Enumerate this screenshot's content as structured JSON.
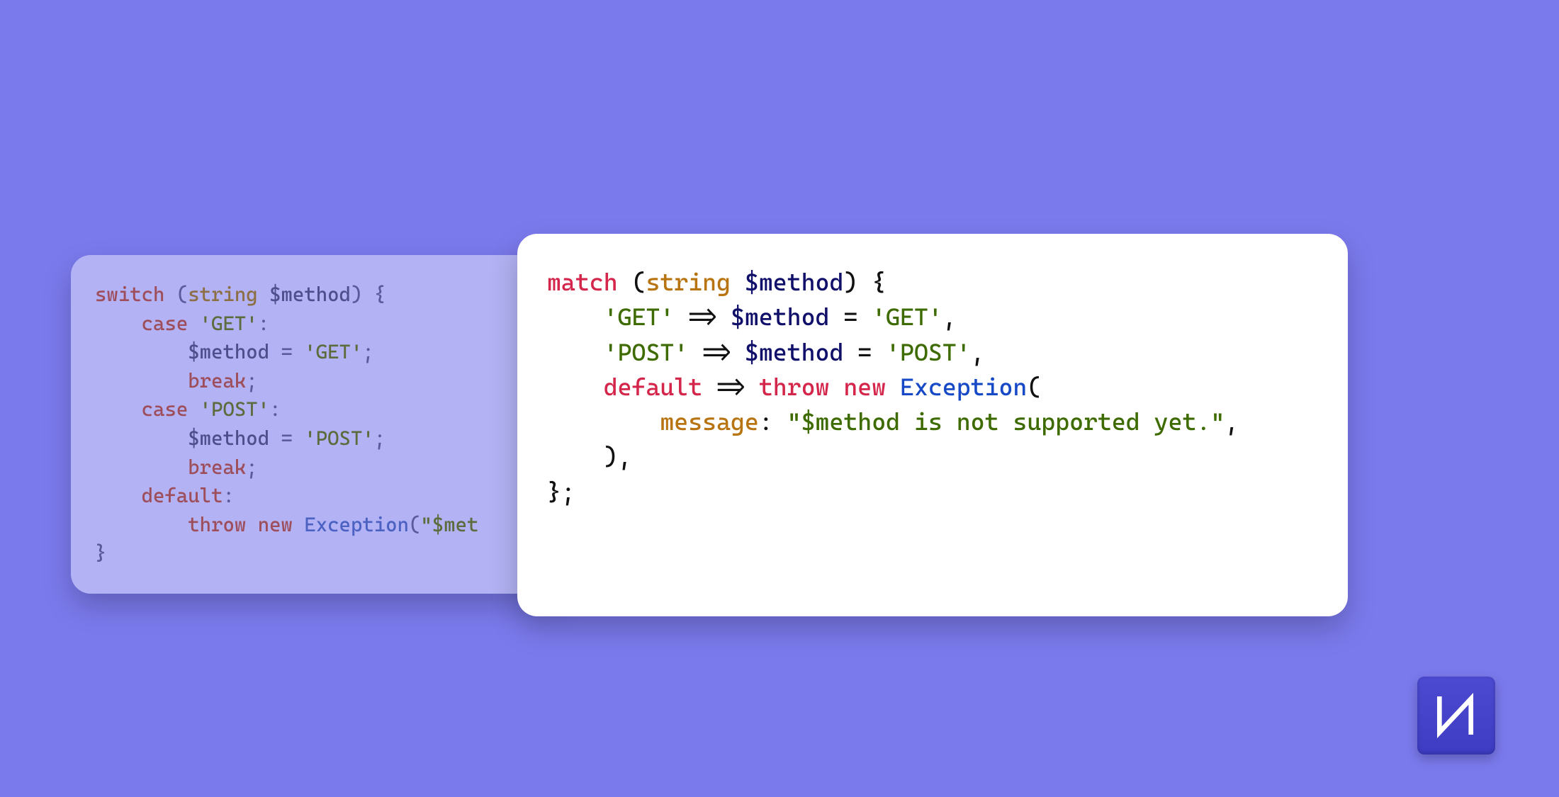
{
  "colors": {
    "background": "#7B7AED",
    "left_card_bg": "rgba(255,255,255,0.42)",
    "right_card_bg": "#ffffff",
    "keyword": "#D4264B",
    "type": "#B77410",
    "variable": "#10106A",
    "string": "#3E6B00",
    "class": "#1749C7"
  },
  "logo": {
    "letters": "LN"
  },
  "left_code": {
    "tokens": [
      [
        {
          "c": "kw",
          "t": "switch"
        },
        {
          "c": "norm",
          "t": " ("
        },
        {
          "c": "type",
          "t": "string"
        },
        {
          "c": "norm",
          "t": " "
        },
        {
          "c": "var",
          "t": "$method"
        },
        {
          "c": "norm",
          "t": ") {"
        }
      ],
      [
        {
          "c": "norm",
          "t": "    "
        },
        {
          "c": "kw",
          "t": "case"
        },
        {
          "c": "norm",
          "t": " "
        },
        {
          "c": "str",
          "t": "'GET'"
        },
        {
          "c": "norm",
          "t": ":"
        }
      ],
      [
        {
          "c": "norm",
          "t": "        "
        },
        {
          "c": "var",
          "t": "$method"
        },
        {
          "c": "norm",
          "t": " = "
        },
        {
          "c": "str",
          "t": "'GET'"
        },
        {
          "c": "norm",
          "t": ";"
        }
      ],
      [
        {
          "c": "norm",
          "t": "        "
        },
        {
          "c": "kw",
          "t": "break"
        },
        {
          "c": "norm",
          "t": ";"
        }
      ],
      [
        {
          "c": "norm",
          "t": "    "
        },
        {
          "c": "kw",
          "t": "case"
        },
        {
          "c": "norm",
          "t": " "
        },
        {
          "c": "str",
          "t": "'POST'"
        },
        {
          "c": "norm",
          "t": ":"
        }
      ],
      [
        {
          "c": "norm",
          "t": "        "
        },
        {
          "c": "var",
          "t": "$method"
        },
        {
          "c": "norm",
          "t": " = "
        },
        {
          "c": "str",
          "t": "'POST'"
        },
        {
          "c": "norm",
          "t": ";"
        }
      ],
      [
        {
          "c": "norm",
          "t": "        "
        },
        {
          "c": "kw",
          "t": "break"
        },
        {
          "c": "norm",
          "t": ";"
        }
      ],
      [
        {
          "c": "norm",
          "t": "    "
        },
        {
          "c": "kw",
          "t": "default"
        },
        {
          "c": "norm",
          "t": ":"
        }
      ],
      [
        {
          "c": "norm",
          "t": "        "
        },
        {
          "c": "kw",
          "t": "throw"
        },
        {
          "c": "norm",
          "t": " "
        },
        {
          "c": "kw",
          "t": "new"
        },
        {
          "c": "norm",
          "t": " "
        },
        {
          "c": "cls",
          "t": "Exception"
        },
        {
          "c": "norm",
          "t": "("
        },
        {
          "c": "str",
          "t": "\"$met"
        }
      ],
      [
        {
          "c": "norm",
          "t": "}"
        }
      ]
    ]
  },
  "right_code": {
    "tokens": [
      [
        {
          "c": "kw",
          "t": "match"
        },
        {
          "c": "norm",
          "t": " ("
        },
        {
          "c": "type",
          "t": "string"
        },
        {
          "c": "norm",
          "t": " "
        },
        {
          "c": "var",
          "t": "$method"
        },
        {
          "c": "norm",
          "t": ") {"
        }
      ],
      [
        {
          "c": "norm",
          "t": "    "
        },
        {
          "c": "str",
          "t": "'GET'"
        },
        {
          "c": "norm",
          "t": " => "
        },
        {
          "c": "var",
          "t": "$method"
        },
        {
          "c": "norm",
          "t": " = "
        },
        {
          "c": "str",
          "t": "'GET'"
        },
        {
          "c": "norm",
          "t": ","
        }
      ],
      [
        {
          "c": "norm",
          "t": "    "
        },
        {
          "c": "str",
          "t": "'POST'"
        },
        {
          "c": "norm",
          "t": " => "
        },
        {
          "c": "var",
          "t": "$method"
        },
        {
          "c": "norm",
          "t": " = "
        },
        {
          "c": "str",
          "t": "'POST'"
        },
        {
          "c": "norm",
          "t": ","
        }
      ],
      [
        {
          "c": "norm",
          "t": "    "
        },
        {
          "c": "kw",
          "t": "default"
        },
        {
          "c": "norm",
          "t": " => "
        },
        {
          "c": "kw",
          "t": "throw"
        },
        {
          "c": "norm",
          "t": " "
        },
        {
          "c": "kw",
          "t": "new"
        },
        {
          "c": "norm",
          "t": " "
        },
        {
          "c": "cls",
          "t": "Exception"
        },
        {
          "c": "norm",
          "t": "("
        }
      ],
      [
        {
          "c": "norm",
          "t": "        "
        },
        {
          "c": "named",
          "t": "message"
        },
        {
          "c": "norm",
          "t": ": "
        },
        {
          "c": "str",
          "t": "\"$method is not supported yet.\""
        },
        {
          "c": "norm",
          "t": ","
        }
      ],
      [
        {
          "c": "norm",
          "t": "    ),"
        }
      ],
      [
        {
          "c": "norm",
          "t": "};"
        }
      ]
    ]
  }
}
